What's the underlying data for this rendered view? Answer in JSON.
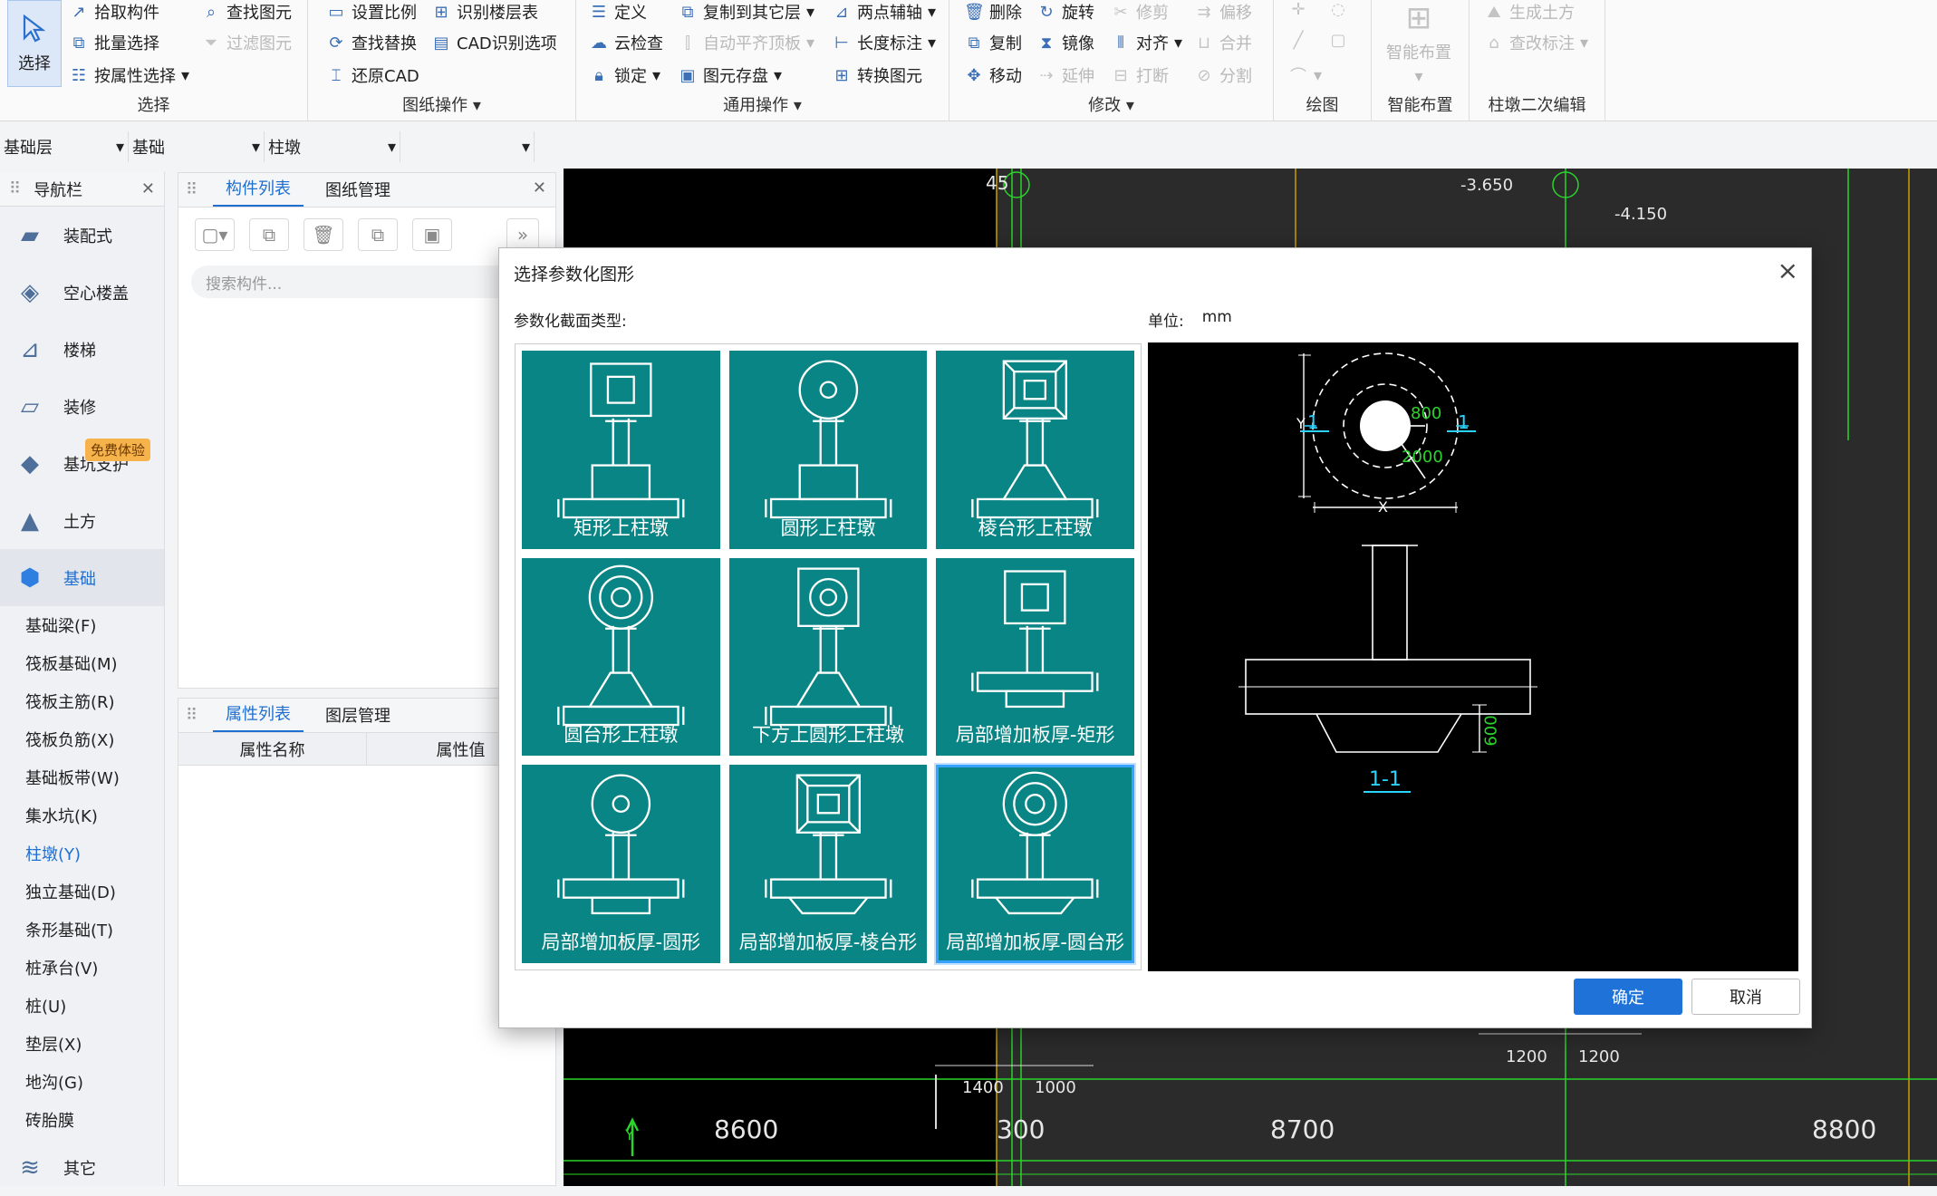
{
  "ribbon": {
    "select": {
      "label": "选择",
      "items": [
        "拾取构件",
        "批量选择",
        "按属性选择"
      ],
      "caption": "选择"
    },
    "drawing_ops": {
      "items": [
        "查找图元",
        "过滤图元",
        "设置比例",
        "查找替换",
        "还原CAD",
        "识别楼层表",
        "CAD识别选项"
      ],
      "caption": "图纸操作"
    },
    "general_ops": {
      "items": [
        "定义",
        "云检查",
        "锁定",
        "复制到其它层",
        "自动平齐顶板",
        "图元存盘",
        "两点辅轴",
        "长度标注",
        "转换图元"
      ],
      "caption": "通用操作"
    },
    "modify": {
      "items": [
        "删除",
        "复制",
        "移动",
        "旋转",
        "镜像",
        "延伸",
        "修剪",
        "对齐",
        "打断",
        "偏移",
        "合并",
        "分割"
      ],
      "caption": "修改"
    },
    "draw": {
      "caption": "绘图"
    },
    "smart": {
      "label": "智能布置",
      "caption": "智能布置"
    },
    "pier_edit": {
      "items": [
        "生成土方",
        "查改标注"
      ],
      "caption": "柱墩二次编辑"
    }
  },
  "layerbar": [
    "基础层",
    "基础",
    "柱墩",
    ""
  ],
  "nav": {
    "title": "导航栏",
    "categories": [
      {
        "label": "装配式",
        "icon": "prefab-icon"
      },
      {
        "label": "空心楼盖",
        "icon": "hollow-slab-icon"
      },
      {
        "label": "楼梯",
        "icon": "stairs-icon"
      },
      {
        "label": "装修",
        "icon": "decoration-icon"
      },
      {
        "label": "基坑支护",
        "icon": "excavation-icon"
      },
      {
        "label": "土方",
        "icon": "earthwork-icon"
      },
      {
        "label": "基础",
        "icon": "foundation-icon"
      }
    ],
    "badge": "免费体验",
    "sub_items": [
      "基础梁(F)",
      "筏板基础(M)",
      "筏板主筋(R)",
      "筏板负筋(X)",
      "基础板带(W)",
      "集水坑(K)",
      "柱墩(Y)",
      "独立基础(D)",
      "条形基础(T)",
      "桩承台(V)",
      "桩(U)",
      "垫层(X)",
      "地沟(G)",
      "砖胎膜"
    ],
    "other": "其它"
  },
  "components": {
    "tab1": "构件列表",
    "tab2": "图纸管理",
    "search_placeholder": "搜索构件..."
  },
  "properties": {
    "tab1": "属性列表",
    "tab2": "图层管理",
    "col1": "属性名称",
    "col2": "属性值"
  },
  "cad_labels": {
    "dims_bottom": [
      "8600",
      "300",
      "8700",
      "8800"
    ],
    "dims_small": [
      "1400",
      "1000",
      "1200",
      "1200"
    ],
    "elev": [
      "-3.650",
      "-4.150"
    ],
    "axis": "45"
  },
  "dialog": {
    "title": "选择参数化图形",
    "subtitle": "参数化截面类型:",
    "unit_label": "单位:",
    "unit_value": "mm",
    "shapes": [
      "矩形上柱墩",
      "圆形上柱墩",
      "棱台形上柱墩",
      "圆台形上柱墩",
      "下方上圆形上柱墩",
      "局部增加板厚-矩形",
      "局部增加板厚-圆形",
      "局部增加板厚-棱台形",
      "局部增加板厚-圆台形"
    ],
    "selected_index": 8,
    "preview": {
      "d_inner": "800",
      "d_outer": "2000",
      "thickness": "600",
      "section_mark": "1",
      "section_title": "1-1",
      "x_label": "X",
      "y_label": "Y"
    },
    "ok": "确定",
    "cancel": "取消"
  },
  "colors": {
    "accent": "#1f73d8",
    "tile": "#0a8585",
    "dim_green": "#2bd42b",
    "cad_cyan": "#2ad4ff"
  }
}
